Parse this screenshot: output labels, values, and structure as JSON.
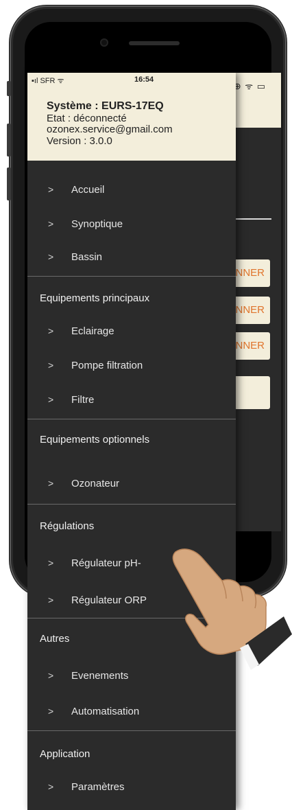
{
  "status_bar": {
    "carrier": "SFR",
    "time": "16:54"
  },
  "header": {
    "system": "Système : EURS-17EQ",
    "state": "Etat : déconnecté",
    "email": "ozonex.service@gmail.com",
    "version": "Version : 3.0.0"
  },
  "menu": {
    "top_items": [
      {
        "chevron": ">",
        "label": "Accueil"
      },
      {
        "chevron": ">",
        "label": "Synoptique"
      },
      {
        "chevron": ">",
        "label": "Bassin"
      }
    ],
    "sections": [
      {
        "title": "Equipements principaux",
        "items": [
          {
            "chevron": ">",
            "label": "Eclairage"
          },
          {
            "chevron": ">",
            "label": "Pompe filtration"
          },
          {
            "chevron": ">",
            "label": "Filtre"
          }
        ]
      },
      {
        "title": "Equipements optionnels",
        "items": [
          {
            "chevron": ">",
            "label": "Ozonateur"
          }
        ]
      },
      {
        "title": "Régulations",
        "items": [
          {
            "chevron": ">",
            "label": "Régulateur pH-"
          },
          {
            "chevron": ">",
            "label": "Régulateur ORP"
          }
        ]
      },
      {
        "title": "Autres",
        "items": [
          {
            "chevron": ">",
            "label": "Evenements"
          },
          {
            "chevron": ">",
            "label": "Automatisation"
          }
        ]
      },
      {
        "title": "Application",
        "items": [
          {
            "chevron": ">",
            "label": "Paramètres"
          }
        ]
      }
    ]
  },
  "background_buttons": [
    "NNER",
    "NNER",
    "NNER"
  ],
  "colors": {
    "accent": "#e0742c",
    "header_bg": "#f3eedb",
    "drawer_bg": "#2b2b2b"
  }
}
